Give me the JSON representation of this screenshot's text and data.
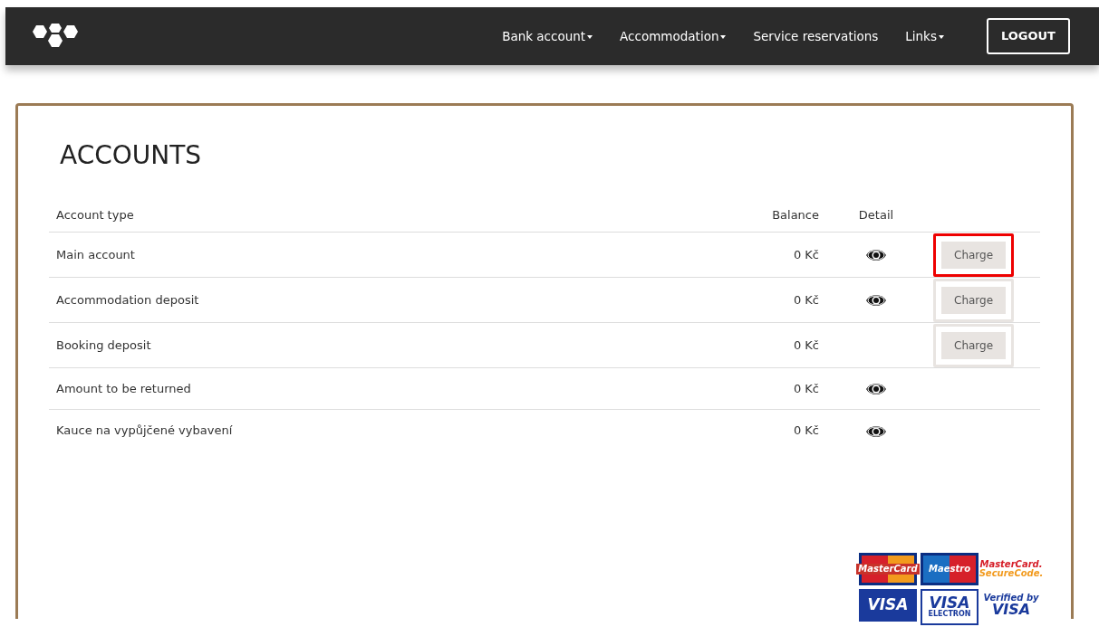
{
  "navbar": {
    "menu": [
      {
        "label": "Bank account",
        "dropdown": true
      },
      {
        "label": "Accommodation",
        "dropdown": true
      },
      {
        "label": "Service reservations",
        "dropdown": false
      },
      {
        "label": "Links",
        "dropdown": true
      }
    ],
    "logout": "LOGOUT"
  },
  "accounts": {
    "title": "ACCOUNTS",
    "columns": [
      "Account type",
      "Balance",
      "Detail"
    ],
    "rows": [
      {
        "type": "Main account",
        "balance": "0 Kč",
        "detail": true,
        "charge": "Charge",
        "highlighted": true
      },
      {
        "type": "Accommodation deposit",
        "balance": "0 Kč",
        "detail": true,
        "charge": "Charge",
        "highlighted": false
      },
      {
        "type": "Booking deposit",
        "balance": "0 Kč",
        "detail": false,
        "charge": "Charge",
        "highlighted": false
      },
      {
        "type": "Amount to be returned",
        "balance": "0 Kč",
        "detail": true
      },
      {
        "type": "Kauce na vypůjčené vybavení",
        "balance": "0 Kč",
        "detail": true
      }
    ]
  },
  "payment_logos": [
    {
      "kind": "mastercard",
      "lines": [
        "MasterCard"
      ]
    },
    {
      "kind": "maestro",
      "lines": [
        "Maestro"
      ]
    },
    {
      "kind": "securecode",
      "lines": [
        "MasterCard.",
        "SecureCode."
      ]
    },
    {
      "kind": "visa",
      "lines": [
        "VISA"
      ]
    },
    {
      "kind": "electron",
      "lines": [
        "VISA",
        "ELECTRON"
      ]
    },
    {
      "kind": "verified",
      "lines": [
        "Verified by",
        "VISA"
      ]
    }
  ]
}
